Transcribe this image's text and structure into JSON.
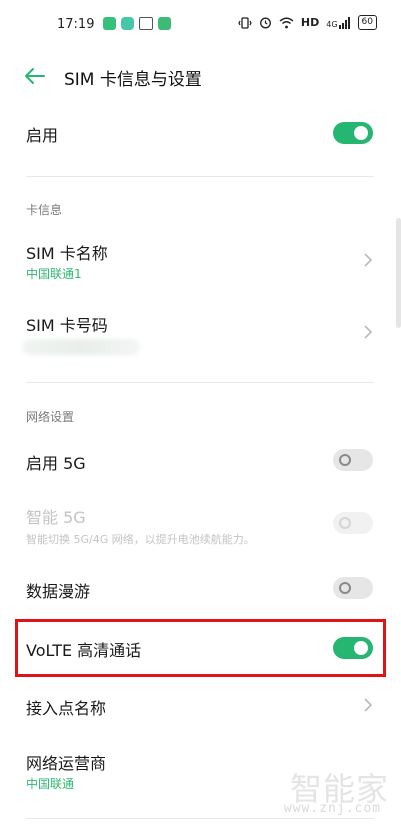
{
  "status_bar": {
    "time": "17:19",
    "hd": "HD",
    "signal": "4G",
    "battery": "60"
  },
  "app_bar": {
    "title": "SIM 卡信息与设置"
  },
  "enable": {
    "label": "启用",
    "state": "on"
  },
  "card_info": {
    "header": "卡信息",
    "sim_name": {
      "label": "SIM 卡名称",
      "value": "中国联通1"
    },
    "sim_number": {
      "label": "SIM 卡号码"
    }
  },
  "network": {
    "header": "网络设置",
    "enable_5g": {
      "label": "启用 5G",
      "state": "off"
    },
    "smart_5g": {
      "label": "智能 5G",
      "desc": "智能切换 5G/4G 网络，以提升电池续航能力。",
      "state": "disabled"
    },
    "roaming": {
      "label": "数据漫游",
      "state": "off"
    },
    "volte": {
      "label": "VoLTE 高清通话",
      "state": "on"
    },
    "apn": {
      "label": "接入点名称"
    },
    "operator": {
      "label": "网络运营商",
      "value": "中国联通"
    }
  },
  "watermark": {
    "big": "智能家",
    "small": "www.znj.com"
  },
  "colors": {
    "accent": "#25b771",
    "highlight": "#e01414"
  }
}
